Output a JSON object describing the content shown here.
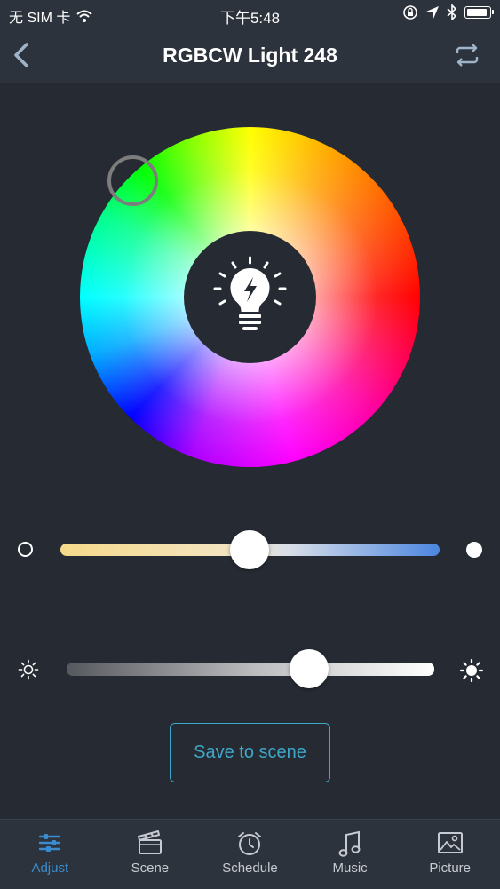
{
  "status_bar": {
    "carrier": "无 SIM 卡",
    "time": "下午5:48",
    "battery_level": 0.95
  },
  "header": {
    "title": "RGBCW Light 248",
    "back_icon": "chevron-left-icon",
    "switch_icon": "repeat-icon"
  },
  "color_wheel": {
    "center_icon": "lightbulb-icon"
  },
  "sliders": {
    "color_temperature": {
      "value_percent": 50,
      "left_icon": "ring-icon",
      "right_icon": "dot-icon"
    },
    "brightness": {
      "value_percent": 66,
      "left_icon": "sun-small-icon",
      "right_icon": "sun-large-icon"
    }
  },
  "save_button": {
    "label": "Save to scene"
  },
  "tab_bar": {
    "tabs": [
      {
        "label": "Adjust",
        "icon": "sliders-icon",
        "active": true
      },
      {
        "label": "Scene",
        "icon": "clapperboard-icon",
        "active": false
      },
      {
        "label": "Schedule",
        "icon": "alarm-clock-icon",
        "active": false
      },
      {
        "label": "Music",
        "icon": "music-note-icon",
        "active": false
      },
      {
        "label": "Picture",
        "icon": "picture-icon",
        "active": false
      }
    ]
  },
  "colors": {
    "background": "#262b33",
    "bar": "#2d333c",
    "accent": "#3fa7c8",
    "tab_active": "#3a8ccf"
  }
}
